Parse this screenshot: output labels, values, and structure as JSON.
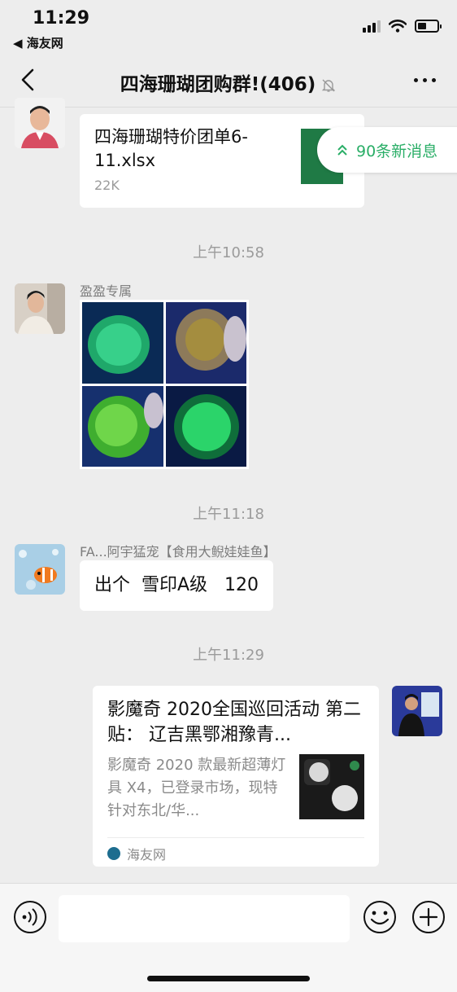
{
  "status_bar": {
    "time": "11:29",
    "back_app": "◀ 海友网"
  },
  "nav": {
    "title": "四海珊瑚团购群!(406)"
  },
  "new_messages": {
    "label": "90条新消息"
  },
  "messages": {
    "file": {
      "name": "四海珊瑚特价团单6-11.xlsx",
      "size": "22K"
    },
    "time1": "上午10:58",
    "images": {
      "sender": "盈盈专属"
    },
    "time2": "上午11:18",
    "text": {
      "sender": "FA...阿宇猛宠【食用大鲵娃娃鱼】",
      "content": "出个  雪印A级   120"
    },
    "time3": "上午11:29",
    "card": {
      "title": "影魔奇 2020全国巡回活动 第二贴： 辽吉黑鄂湘豫青...",
      "description": "影魔奇 2020 款最新超薄灯具 X4，已登录市场，现特针对东北/华...",
      "source": "海友网"
    }
  },
  "colors": {
    "accent_green": "#2aae67",
    "excel_green": "#1f7a45",
    "background": "#ededed"
  }
}
